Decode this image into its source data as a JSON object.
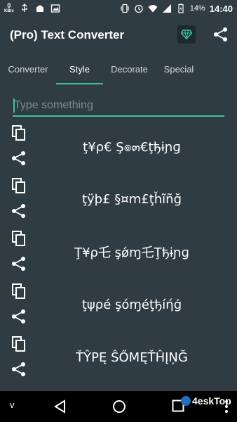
{
  "status_bar": {
    "net_speed_value": "0",
    "net_speed_unit": "KB/s",
    "battery_percent": "14%",
    "time": "14:40"
  },
  "app_bar": {
    "title": "(Pro) Text Converter"
  },
  "tabs": [
    {
      "label": "Converter",
      "active": false
    },
    {
      "label": "Style",
      "active": true
    },
    {
      "label": "Decorate",
      "active": false
    },
    {
      "label": "Special",
      "active": false
    }
  ],
  "input": {
    "value": "",
    "placeholder": "Type something"
  },
  "results": [
    {
      "text": "ţ¥ρ€ Ş๏๓€ţђɨɲɡ"
    },
    {
      "text": "ţÿϸ£ §¤m£ţȟĩñğ"
    },
    {
      "text": "Ţ¥ρ乇 şǿɱ乇Ţђɨɲɡ"
    },
    {
      "text": "ţψρé şóɱéţђíήģ"
    },
    {
      "text": "ŤŶPĘ ŜŐMĘŤĤĮŅĞ"
    }
  ],
  "nav_bar": {
    "left_label": "v"
  },
  "watermark": {
    "text": "4eskTop"
  },
  "colors": {
    "background": "#2f3c43",
    "accent": "#3fc1a5",
    "nav_bar": "#000000"
  },
  "icons": {
    "pro": "diamond-icon",
    "share": "share-icon",
    "copy": "copy-icon"
  }
}
